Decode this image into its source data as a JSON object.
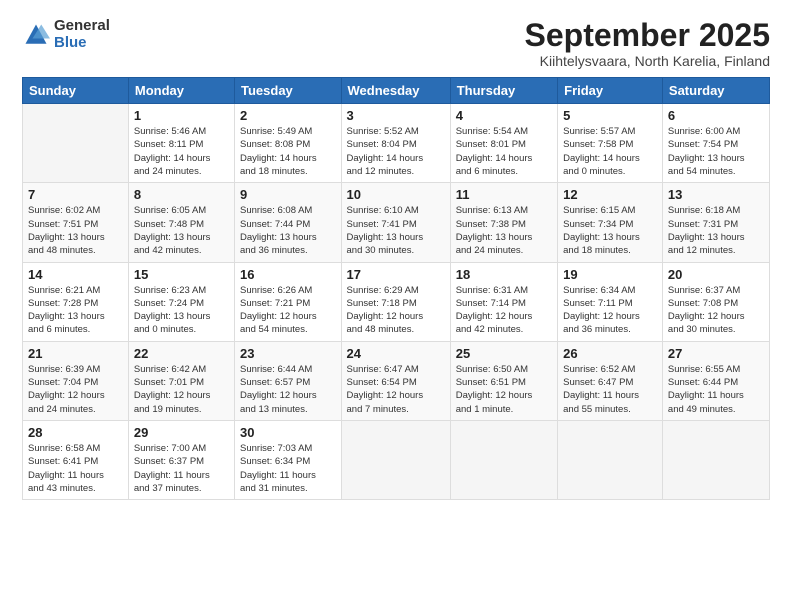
{
  "header": {
    "logo_general": "General",
    "logo_blue": "Blue",
    "title": "September 2025",
    "subtitle": "Kiihtelysvaara, North Karelia, Finland"
  },
  "days_of_week": [
    "Sunday",
    "Monday",
    "Tuesday",
    "Wednesday",
    "Thursday",
    "Friday",
    "Saturday"
  ],
  "weeks": [
    [
      {
        "day": "",
        "info": ""
      },
      {
        "day": "1",
        "info": "Sunrise: 5:46 AM\nSunset: 8:11 PM\nDaylight: 14 hours\nand 24 minutes."
      },
      {
        "day": "2",
        "info": "Sunrise: 5:49 AM\nSunset: 8:08 PM\nDaylight: 14 hours\nand 18 minutes."
      },
      {
        "day": "3",
        "info": "Sunrise: 5:52 AM\nSunset: 8:04 PM\nDaylight: 14 hours\nand 12 minutes."
      },
      {
        "day": "4",
        "info": "Sunrise: 5:54 AM\nSunset: 8:01 PM\nDaylight: 14 hours\nand 6 minutes."
      },
      {
        "day": "5",
        "info": "Sunrise: 5:57 AM\nSunset: 7:58 PM\nDaylight: 14 hours\nand 0 minutes."
      },
      {
        "day": "6",
        "info": "Sunrise: 6:00 AM\nSunset: 7:54 PM\nDaylight: 13 hours\nand 54 minutes."
      }
    ],
    [
      {
        "day": "7",
        "info": "Sunrise: 6:02 AM\nSunset: 7:51 PM\nDaylight: 13 hours\nand 48 minutes."
      },
      {
        "day": "8",
        "info": "Sunrise: 6:05 AM\nSunset: 7:48 PM\nDaylight: 13 hours\nand 42 minutes."
      },
      {
        "day": "9",
        "info": "Sunrise: 6:08 AM\nSunset: 7:44 PM\nDaylight: 13 hours\nand 36 minutes."
      },
      {
        "day": "10",
        "info": "Sunrise: 6:10 AM\nSunset: 7:41 PM\nDaylight: 13 hours\nand 30 minutes."
      },
      {
        "day": "11",
        "info": "Sunrise: 6:13 AM\nSunset: 7:38 PM\nDaylight: 13 hours\nand 24 minutes."
      },
      {
        "day": "12",
        "info": "Sunrise: 6:15 AM\nSunset: 7:34 PM\nDaylight: 13 hours\nand 18 minutes."
      },
      {
        "day": "13",
        "info": "Sunrise: 6:18 AM\nSunset: 7:31 PM\nDaylight: 13 hours\nand 12 minutes."
      }
    ],
    [
      {
        "day": "14",
        "info": "Sunrise: 6:21 AM\nSunset: 7:28 PM\nDaylight: 13 hours\nand 6 minutes."
      },
      {
        "day": "15",
        "info": "Sunrise: 6:23 AM\nSunset: 7:24 PM\nDaylight: 13 hours\nand 0 minutes."
      },
      {
        "day": "16",
        "info": "Sunrise: 6:26 AM\nSunset: 7:21 PM\nDaylight: 12 hours\nand 54 minutes."
      },
      {
        "day": "17",
        "info": "Sunrise: 6:29 AM\nSunset: 7:18 PM\nDaylight: 12 hours\nand 48 minutes."
      },
      {
        "day": "18",
        "info": "Sunrise: 6:31 AM\nSunset: 7:14 PM\nDaylight: 12 hours\nand 42 minutes."
      },
      {
        "day": "19",
        "info": "Sunrise: 6:34 AM\nSunset: 7:11 PM\nDaylight: 12 hours\nand 36 minutes."
      },
      {
        "day": "20",
        "info": "Sunrise: 6:37 AM\nSunset: 7:08 PM\nDaylight: 12 hours\nand 30 minutes."
      }
    ],
    [
      {
        "day": "21",
        "info": "Sunrise: 6:39 AM\nSunset: 7:04 PM\nDaylight: 12 hours\nand 24 minutes."
      },
      {
        "day": "22",
        "info": "Sunrise: 6:42 AM\nSunset: 7:01 PM\nDaylight: 12 hours\nand 19 minutes."
      },
      {
        "day": "23",
        "info": "Sunrise: 6:44 AM\nSunset: 6:57 PM\nDaylight: 12 hours\nand 13 minutes."
      },
      {
        "day": "24",
        "info": "Sunrise: 6:47 AM\nSunset: 6:54 PM\nDaylight: 12 hours\nand 7 minutes."
      },
      {
        "day": "25",
        "info": "Sunrise: 6:50 AM\nSunset: 6:51 PM\nDaylight: 12 hours\nand 1 minute."
      },
      {
        "day": "26",
        "info": "Sunrise: 6:52 AM\nSunset: 6:47 PM\nDaylight: 11 hours\nand 55 minutes."
      },
      {
        "day": "27",
        "info": "Sunrise: 6:55 AM\nSunset: 6:44 PM\nDaylight: 11 hours\nand 49 minutes."
      }
    ],
    [
      {
        "day": "28",
        "info": "Sunrise: 6:58 AM\nSunset: 6:41 PM\nDaylight: 11 hours\nand 43 minutes."
      },
      {
        "day": "29",
        "info": "Sunrise: 7:00 AM\nSunset: 6:37 PM\nDaylight: 11 hours\nand 37 minutes."
      },
      {
        "day": "30",
        "info": "Sunrise: 7:03 AM\nSunset: 6:34 PM\nDaylight: 11 hours\nand 31 minutes."
      },
      {
        "day": "",
        "info": ""
      },
      {
        "day": "",
        "info": ""
      },
      {
        "day": "",
        "info": ""
      },
      {
        "day": "",
        "info": ""
      }
    ]
  ]
}
